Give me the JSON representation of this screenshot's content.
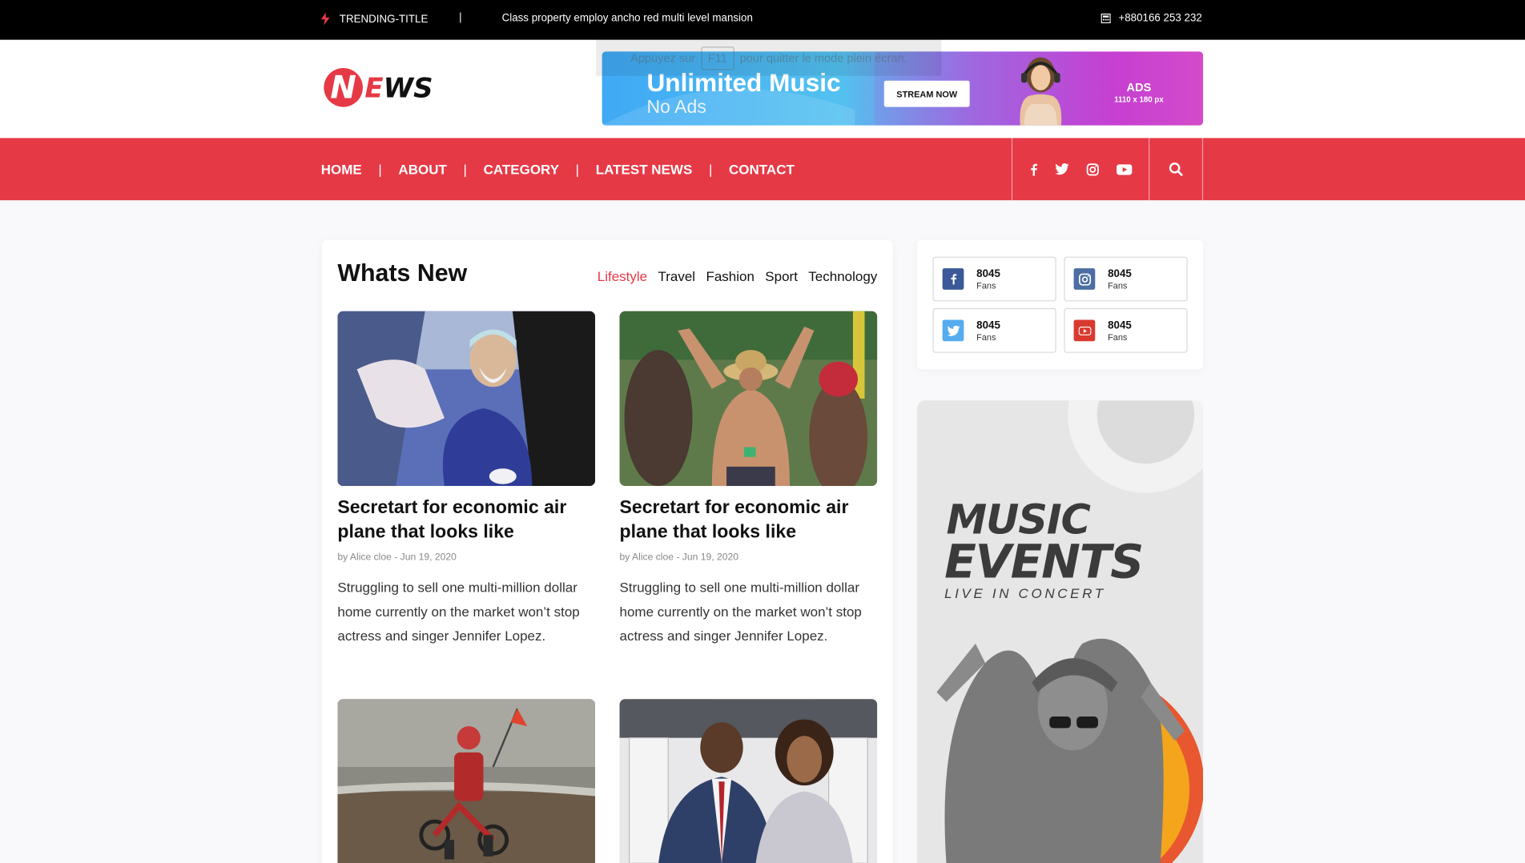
{
  "topbar": {
    "trending_label": "TRENDING-TITLE",
    "separator": "|",
    "headline": "Class property employ ancho red multi level mansion",
    "phone": "+880166 253 232"
  },
  "fullscreen_notice": {
    "before": "Appuyez sur",
    "key": "F11",
    "after": "pour quitter le mode plein écran."
  },
  "logo": {
    "first": "N",
    "second": "E",
    "rest": "WS"
  },
  "ad": {
    "title": "Unlimited Music",
    "subtitle": "No Ads",
    "button": "STREAM NOW",
    "label": "ADS",
    "size": "1110 x 180 px"
  },
  "nav": {
    "items": [
      "HOME",
      "ABOUT",
      "CATEGORY",
      "LATEST NEWS",
      "CONTACT"
    ],
    "separator": "|"
  },
  "whats_new": {
    "title": "Whats New",
    "tabs": [
      {
        "label": "Lifestyle",
        "active": true
      },
      {
        "label": "Travel",
        "active": false
      },
      {
        "label": "Fashion",
        "active": false
      },
      {
        "label": "Sport",
        "active": false
      },
      {
        "label": "Technology",
        "active": false
      }
    ],
    "articles": [
      {
        "title": "Secretart for economic air plane that looks like",
        "meta": "by Alice cloe - Jun 19, 2020",
        "desc": "Struggling to sell one multi-million dollar home currently on the market won’t stop actress and singer Jennifer Lopez."
      },
      {
        "title": "Secretart for economic air plane that looks like",
        "meta": "by Alice cloe - Jun 19, 2020",
        "desc": "Struggling to sell one multi-million dollar home currently on the market won’t stop actress and singer Jennifer Lopez."
      }
    ]
  },
  "fans": [
    {
      "network": "facebook",
      "count": "8045",
      "label": "Fans",
      "color": "#3b5998"
    },
    {
      "network": "instagram",
      "count": "8045",
      "label": "Fans",
      "color": "#4c6ea3"
    },
    {
      "network": "twitter",
      "count": "8045",
      "label": "Fans",
      "color": "#55acee"
    },
    {
      "network": "youtube",
      "count": "8045",
      "label": "Fans",
      "color": "#d93a2f"
    }
  ],
  "music_ad": {
    "line1": "MUSIC",
    "line2": "EVENTS",
    "line3": "LIVE IN CONCERT"
  },
  "colors": {
    "accent": "#e63946",
    "topbar": "#000000"
  }
}
